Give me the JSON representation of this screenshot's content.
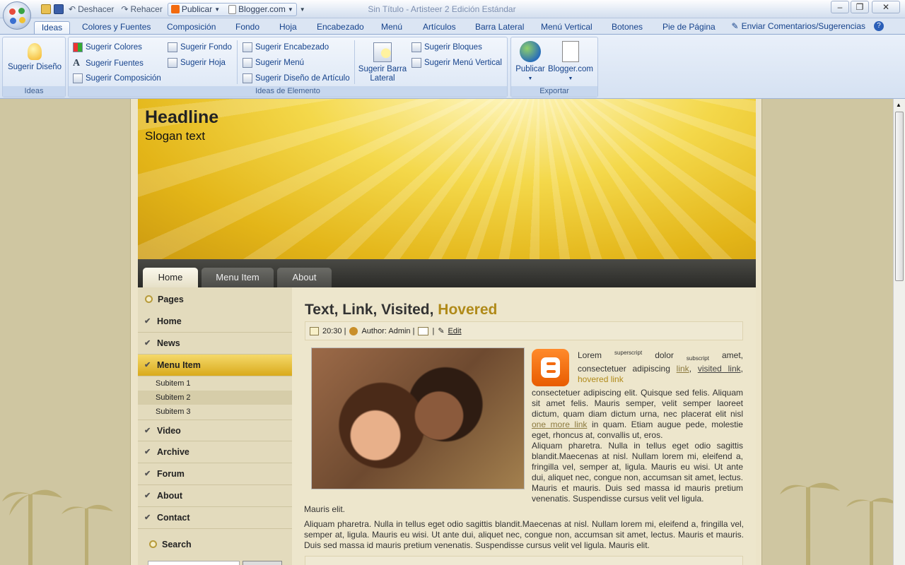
{
  "window": {
    "title": "Sin Título - Artisteer 2 Edición Estándar",
    "qat": {
      "undo": "Deshacer",
      "redo": "Rehacer",
      "publish": "Publicar",
      "blogger": "Blogger.com"
    }
  },
  "ribbon": {
    "tabs": [
      "Ideas",
      "Colores y Fuentes",
      "Composición",
      "Fondo",
      "Hoja",
      "Encabezado",
      "Menú",
      "Artículos",
      "Barra Lateral",
      "Menú Vertical",
      "Botones",
      "Pie de Página"
    ],
    "active_tab": "Ideas",
    "feedback": "Enviar Comentarios/Sugerencias",
    "groups": {
      "ideas": {
        "label": "Ideas",
        "suggest_design": "Sugerir Diseño"
      },
      "element": {
        "label": "Ideas de Elemento",
        "items": [
          "Sugerir Colores",
          "Sugerir Fuentes",
          "Sugerir Composición",
          "Sugerir Fondo",
          "Sugerir Hoja",
          "Sugerir Encabezado",
          "Sugerir Menú",
          "Sugerir Diseño de Artículo",
          "Sugerir Barra Lateral",
          "Sugerir Bloques",
          "Sugerir Menú Vertical"
        ]
      },
      "export": {
        "label": "Exportar",
        "publish": "Publicar",
        "blogger": "Blogger.com"
      }
    }
  },
  "site": {
    "headline": "Headline",
    "slogan": "Slogan text",
    "menu": [
      "Home",
      "Menu Item",
      "About"
    ],
    "sidebar": {
      "pages_title": "Pages",
      "items": [
        "Home",
        "News",
        "Menu Item",
        "Video",
        "Archive",
        "Forum",
        "About",
        "Contact"
      ],
      "subitems": [
        "Subitem 1",
        "Subitem 2",
        "Subitem 3"
      ],
      "search_title": "Search"
    },
    "post": {
      "title_parts": [
        "Text, ",
        "Link, ",
        "Visited, ",
        "Hovered"
      ],
      "time": "20:30 |",
      "author": "Author: Admin |",
      "sep": "|",
      "edit": "Edit",
      "p1": {
        "lorem": "Lorem",
        "sup": "superscript",
        "dolor": "dolor",
        "sub": "subscript",
        "amet": "amet,",
        "line2a": "consectetuer adipiscing",
        "link": "link",
        "comma1": ",",
        "visited": "visited link",
        "comma2": ",",
        "hovered": "hovered link",
        "line3": "consectetuer adipiscing elit. Quisque sed felis. Aliquam sit amet felis. Mauris semper, velit semper laoreet dictum, quam diam dictum urna, nec placerat elit nisl",
        "one_more": "one more link",
        "line4": "in quam. Etiam augue pede, molestie eget, rhoncus at, convallis ut, eros."
      },
      "p2": "Aliquam pharetra. Nulla in tellus eget odio sagittis blandit.Maecenas at nisl. Nullam lorem mi, eleifend a, fringilla vel, semper at, ligula. Mauris eu wisi. Ut ante dui, aliquet nec, congue non, accumsan sit amet, lectus. Mauris et mauris. Duis sed massa id mauris pretium venenatis. Suspendisse cursus velit vel ligula.",
      "p2_tail": "Mauris elit.",
      "p3": "Aliquam pharetra. Nulla in tellus eget odio sagittis blandit.Maecenas at nisl. Nullam lorem mi, eleifend a, fringilla vel, semper at, ligula. Mauris eu wisi. Ut ante dui, aliquet nec, congue non, accumsan sit amet, lectus. Mauris et mauris. Duis sed massa id mauris pretium venenatis. Suspendisse cursus velit vel ligula. Mauris elit."
    }
  },
  "colors": {
    "accent_gold": "#d9aa1c",
    "ribbon_blue": "#15428b",
    "blogger_orange": "#f26a0f"
  }
}
